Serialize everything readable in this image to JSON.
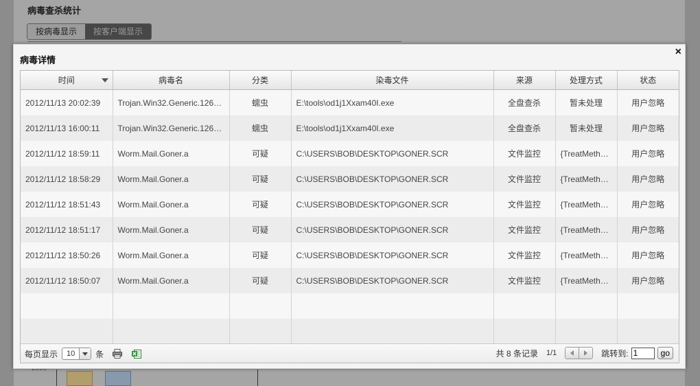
{
  "background": {
    "title": "病毒查杀统计",
    "tabs": [
      "按病毒显示",
      "按客户端显示"
    ],
    "chart_label": "2000"
  },
  "dialog": {
    "title": "病毒详情",
    "close_glyph": "×",
    "columns": [
      "时间",
      "病毒名",
      "分类",
      "染毒文件",
      "来源",
      "处理方式",
      "状态"
    ],
    "rows": [
      [
        "2012/11/13 20:02:39",
        "Trojan.Win32.Generic.126…",
        "蠕虫",
        "E:\\tools\\od1j1Xxam40I.exe",
        "全盘查杀",
        "暂未处理",
        "用户忽略"
      ],
      [
        "2012/11/13 16:00:11",
        "Trojan.Win32.Generic.126…",
        "蠕虫",
        "E:\\tools\\od1j1Xxam40I.exe",
        "全盘查杀",
        "暂未处理",
        "用户忽略"
      ],
      [
        "2012/11/12 18:59:11",
        "Worm.Mail.Goner.a",
        "可疑",
        "C:\\USERS\\BOB\\DESKTOP\\GONER.SCR",
        "文件监控",
        "{TreatMethod}",
        "用户忽略"
      ],
      [
        "2012/11/12 18:58:29",
        "Worm.Mail.Goner.a",
        "可疑",
        "C:\\USERS\\BOB\\DESKTOP\\GONER.SCR",
        "文件监控",
        "{TreatMethod}",
        "用户忽略"
      ],
      [
        "2012/11/12 18:51:43",
        "Worm.Mail.Goner.a",
        "可疑",
        "C:\\USERS\\BOB\\DESKTOP\\GONER.SCR",
        "文件监控",
        "{TreatMethod}",
        "用户忽略"
      ],
      [
        "2012/11/12 18:51:17",
        "Worm.Mail.Goner.a",
        "可疑",
        "C:\\USERS\\BOB\\DESKTOP\\GONER.SCR",
        "文件监控",
        "{TreatMethod}",
        "用户忽略"
      ],
      [
        "2012/11/12 18:50:26",
        "Worm.Mail.Goner.a",
        "可疑",
        "C:\\USERS\\BOB\\DESKTOP\\GONER.SCR",
        "文件监控",
        "{TreatMethod}",
        "用户忽略"
      ],
      [
        "2012/11/12 18:50:07",
        "Worm.Mail.Goner.a",
        "可疑",
        "C:\\USERS\\BOB\\DESKTOP\\GONER.SCR",
        "文件监控",
        "{TreatMethod}",
        "用户忽略"
      ]
    ],
    "empty_rows": 2,
    "footer": {
      "per_page_label": "每页显示",
      "per_page_value": "10",
      "per_page_unit": "条",
      "total_text": "共 8 条记录",
      "page_text": "1/1",
      "jump_label": "跳转到:",
      "jump_value": "1",
      "go_label": "go"
    },
    "icons": {
      "print": "printer-icon",
      "export": "excel-export-icon",
      "sort": "sort-descending-icon"
    }
  }
}
